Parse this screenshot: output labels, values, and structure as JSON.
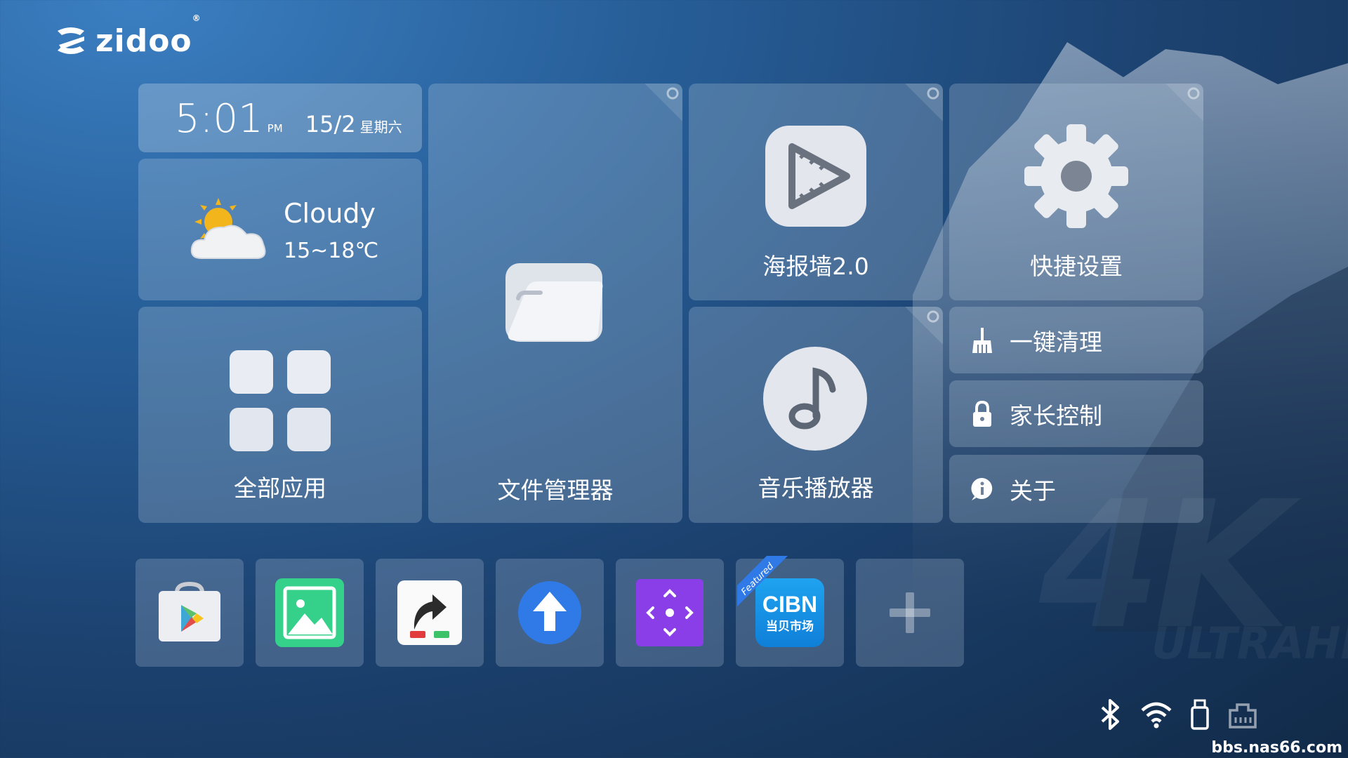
{
  "logo": {
    "text": "zidoo",
    "reg": "®"
  },
  "clock": {
    "time": "5:01",
    "ampm": "PM",
    "date": "15/2",
    "weekday": "星期六"
  },
  "weather": {
    "condition": "Cloudy",
    "temp": "15~18℃",
    "icon": "partly-cloudy-icon"
  },
  "tiles": {
    "apps": {
      "label": "全部应用"
    },
    "file_manager": {
      "label": "文件管理器"
    },
    "poster_wall": {
      "label": "海报墙2.0"
    },
    "settings": {
      "label": "快捷设置"
    },
    "music": {
      "label": "音乐播放器"
    }
  },
  "side_list": [
    {
      "label": "一键清理",
      "icon": "broom-icon"
    },
    {
      "label": "家长控制",
      "icon": "lock-icon"
    },
    {
      "label": "关于",
      "icon": "info-icon"
    }
  ],
  "dock": {
    "featured_label": "Featured",
    "cibn_top": "CIBN",
    "cibn_bottom": "当贝市场",
    "apps": [
      "play-store-icon",
      "gallery-icon",
      "shortcut-app-icon",
      "upload-arrow-icon",
      "dpad-app-icon",
      "cibn-market-icon",
      "add-app-icon"
    ]
  },
  "status_icons": [
    "bluetooth-icon",
    "wifi-icon",
    "usb-drive-icon",
    "ethernet-icon"
  ],
  "background": {
    "big_text": "4K",
    "sub_text": "ULTRAHD"
  },
  "watermark": "bbs.nas66.com"
}
